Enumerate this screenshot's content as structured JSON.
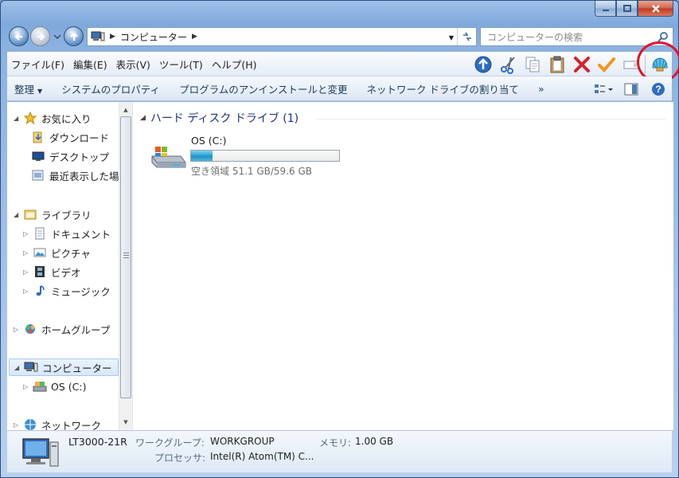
{
  "window": {
    "caption": {
      "minimize": "minimize",
      "maximize": "maximize",
      "close": "close"
    }
  },
  "address": {
    "path": "コンピューター",
    "search_placeholder": "コンピューターの検索"
  },
  "menu": {
    "items": [
      "ファイル(F)",
      "編集(E)",
      "表示(V)",
      "ツール(T)",
      "ヘルプ(H)"
    ]
  },
  "toolbar_icons": [
    "up-arrow-icon",
    "scissors-icon",
    "copy-icon",
    "paste-icon",
    "delete-x-icon",
    "checkmark-icon",
    "rename-icon",
    "shell-icon"
  ],
  "commandbar": {
    "organize": "整理",
    "system_properties": "システムのプロパティ",
    "uninstall": "プログラムのアンインストールと変更",
    "map_drive": "ネットワーク ドライブの割り当て",
    "more": "»"
  },
  "navpane": {
    "favorites": "お気に入り",
    "downloads": "ダウンロード",
    "desktop": "デスクトップ",
    "recent": "最近表示した場所",
    "libraries": "ライブラリ",
    "documents": "ドキュメント",
    "pictures": "ピクチャ",
    "videos": "ビデオ",
    "music": "ミュージック",
    "homegroup": "ホームグループ",
    "computer": "コンピューター",
    "os_drive": "OS (C:)",
    "network": "ネットワーク"
  },
  "content": {
    "group_header": "ハード ディスク ドライブ (1)",
    "drives": [
      {
        "name": "OS (C:)",
        "free_text": "空き領域 51.1 GB/59.6 GB",
        "used_fraction": 0.143
      }
    ]
  },
  "details": {
    "computer_name": "LT3000-21R",
    "workgroup_label": "ワークグループ:",
    "workgroup_value": "WORKGROUP",
    "memory_label": "メモリ:",
    "memory_value": "1.00 GB",
    "processor_label": "プロセッサ:",
    "processor_value": "Intel(R) Atom(TM) C..."
  },
  "colors": {
    "accent": "#1e3287",
    "drive_bar": "#27a2d4",
    "highlight_circle": "#e4112b"
  }
}
